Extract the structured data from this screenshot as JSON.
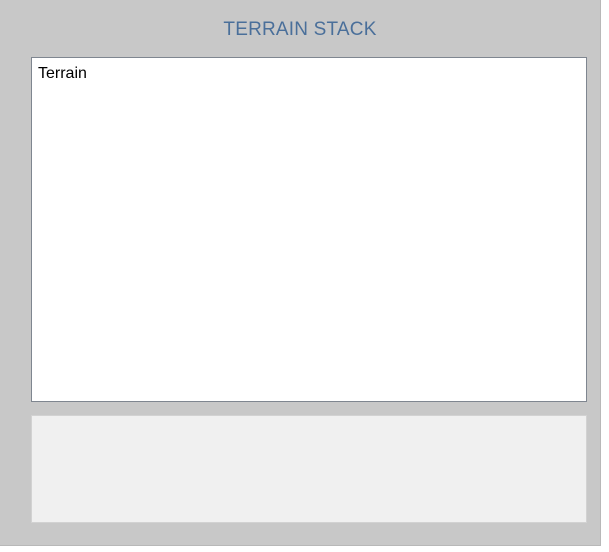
{
  "panel": {
    "title": "TERRAIN STACK",
    "title_color": "#4a6f9a",
    "background": "#c8c8c8"
  },
  "terrain_list": {
    "items": [
      {
        "label": "Terrain"
      }
    ]
  },
  "details_box": {
    "text": ""
  }
}
